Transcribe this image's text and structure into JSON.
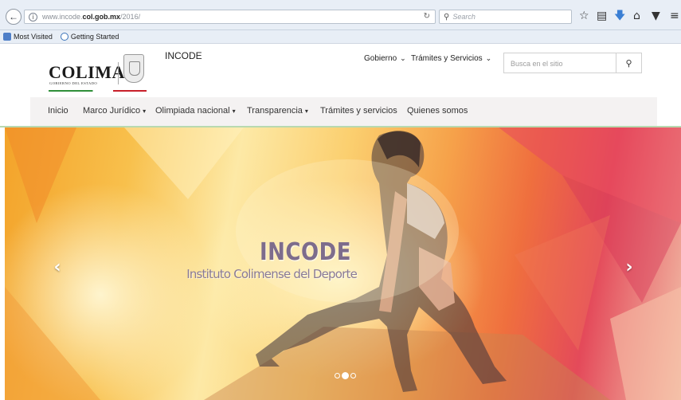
{
  "browser": {
    "url_prefix": "www.incode.",
    "url_domain": "col.gob.mx",
    "url_path": "/2016/",
    "search_placeholder": "Search",
    "icons": [
      "back-arrow-icon",
      "info-icon",
      "reload-icon",
      "search-icon",
      "star-icon",
      "reading-list-icon",
      "download-icon",
      "home-icon",
      "pocket-icon",
      "menu-icon"
    ],
    "bookmarks": [
      {
        "label": "Most Visited",
        "icon": "folder-icon"
      },
      {
        "label": "Getting Started",
        "icon": "firefox-icon"
      }
    ]
  },
  "site": {
    "logo": {
      "name": "COLIMA",
      "subtitle": "GOBIERNO DEL ESTADO"
    },
    "title": "INCODE",
    "top_menu": [
      {
        "label": "Gobierno"
      },
      {
        "label": "Trámites y Servicios"
      }
    ],
    "search_placeholder": "Busca en el sitio",
    "nav": [
      {
        "label": "Inicio",
        "dropdown": false
      },
      {
        "label": "Marco Jurídico",
        "dropdown": true
      },
      {
        "label": "Olimpiada nacional",
        "dropdown": true
      },
      {
        "label": "Transparencia",
        "dropdown": true
      },
      {
        "label": "Trámites y servicios",
        "dropdown": false
      },
      {
        "label": "Quienes somos",
        "dropdown": false
      }
    ],
    "caret": "▾"
  },
  "hero": {
    "title": "INCODE",
    "subtitle": "Instituto Colimense del Deporte",
    "slides_total": 3,
    "active_slide": 2,
    "prev_arrow": "‹",
    "next_arrow": "›"
  },
  "colors": {
    "toolbar_bg": "#e8eef6",
    "nav_bg": "#f4f2f2",
    "green_stripe": "#2f8f3a",
    "red_stripe": "#c8202a"
  }
}
